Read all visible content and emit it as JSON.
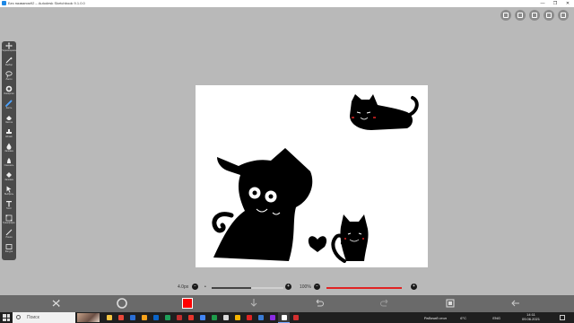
{
  "window": {
    "title": "Без названия92 – Autodesk Sketchbook 9.1.0.0",
    "controls": [
      "—",
      "❐",
      "✕"
    ]
  },
  "top_icons": [
    "brush-library-icon",
    "layers-icon",
    "color-palette-icon",
    "pencil-settings-icon",
    "colors-grid-icon"
  ],
  "tools": [
    {
      "icon": "move-icon",
      "label": "Перемещение"
    },
    {
      "icon": "magic-wand-icon",
      "label": "Выбор"
    },
    {
      "icon": "lasso-icon",
      "label": "Лассо"
    },
    {
      "icon": "circle-fill-icon",
      "label": "Инверсия"
    },
    {
      "icon": "brush-icon",
      "label": "Кисть"
    },
    {
      "icon": "eraser-icon",
      "label": "Ластик"
    },
    {
      "icon": "stamp-icon",
      "label": "Штамп"
    },
    {
      "icon": "drop-icon",
      "label": "Заливка"
    },
    {
      "icon": "smudge-icon",
      "label": "Смешать"
    },
    {
      "icon": "bucket-icon",
      "label": "Заливка"
    },
    {
      "icon": "pointer-icon",
      "label": "Выбрать"
    },
    {
      "icon": "text-icon",
      "label": "Текст"
    },
    {
      "icon": "transform-icon",
      "label": "Трансформ."
    },
    {
      "icon": "line-icon",
      "label": "Линия"
    },
    {
      "icon": "rect-icon",
      "label": "Фигура"
    }
  ],
  "sliders": {
    "size_label": "4.0px",
    "size_value": 0.55,
    "opacity_label": "100%",
    "opacity_value": 1.0,
    "minus": "−",
    "plus": "+"
  },
  "current_color": "#ff0000",
  "action_bar": [
    "shuffle-icon",
    "color-wheel-icon",
    "color-swatch",
    "download-arrow-icon",
    "undo-icon",
    "redo-icon",
    "layers-button-icon",
    "back-arrow-icon"
  ],
  "taskbar": {
    "search_placeholder": "Поиск",
    "apps": [
      {
        "color": "#f5c542"
      },
      {
        "color": "#e8483a"
      },
      {
        "color": "#2b6fd6"
      },
      {
        "color": "#f7a21b"
      },
      {
        "color": "#0a64c8"
      },
      {
        "color": "#1ea05a"
      },
      {
        "color": "#c22e2e"
      },
      {
        "color": "#e7352c"
      },
      {
        "color": "#4285f4"
      },
      {
        "color": "#1f9c4b"
      },
      {
        "color": "#d9d9d9"
      },
      {
        "color": "#f4b400"
      },
      {
        "color": "#e02424"
      },
      {
        "color": "#3a7bd5"
      },
      {
        "color": "#8a2be2"
      },
      {
        "color": "#ffffff",
        "active": true
      },
      {
        "color": "#d32f2f"
      }
    ],
    "tray_desktop": "Рабочий стол",
    "tray_weather": "6°C",
    "tray_lang": "ENG",
    "time": "14:11",
    "date": "09.06.2021"
  }
}
